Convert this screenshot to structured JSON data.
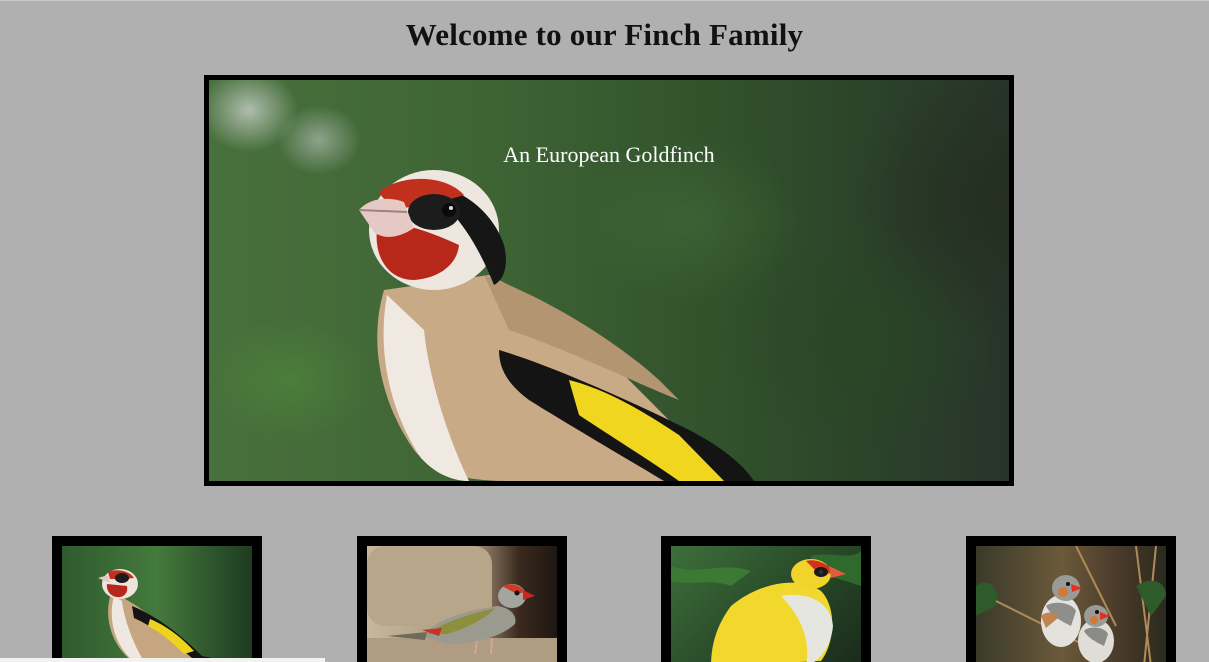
{
  "page": {
    "title": "Welcome to our Finch Family",
    "background_color": "#b0b0b0"
  },
  "hero": {
    "caption": "An European Goldfinch"
  },
  "gallery": {
    "thumbnails": [
      {
        "icon": "european-goldfinch-photo"
      },
      {
        "icon": "red-browed-finch-photo"
      },
      {
        "icon": "yellow-gouldian-finch-photo"
      },
      {
        "icon": "zebra-finches-photo"
      }
    ]
  }
}
